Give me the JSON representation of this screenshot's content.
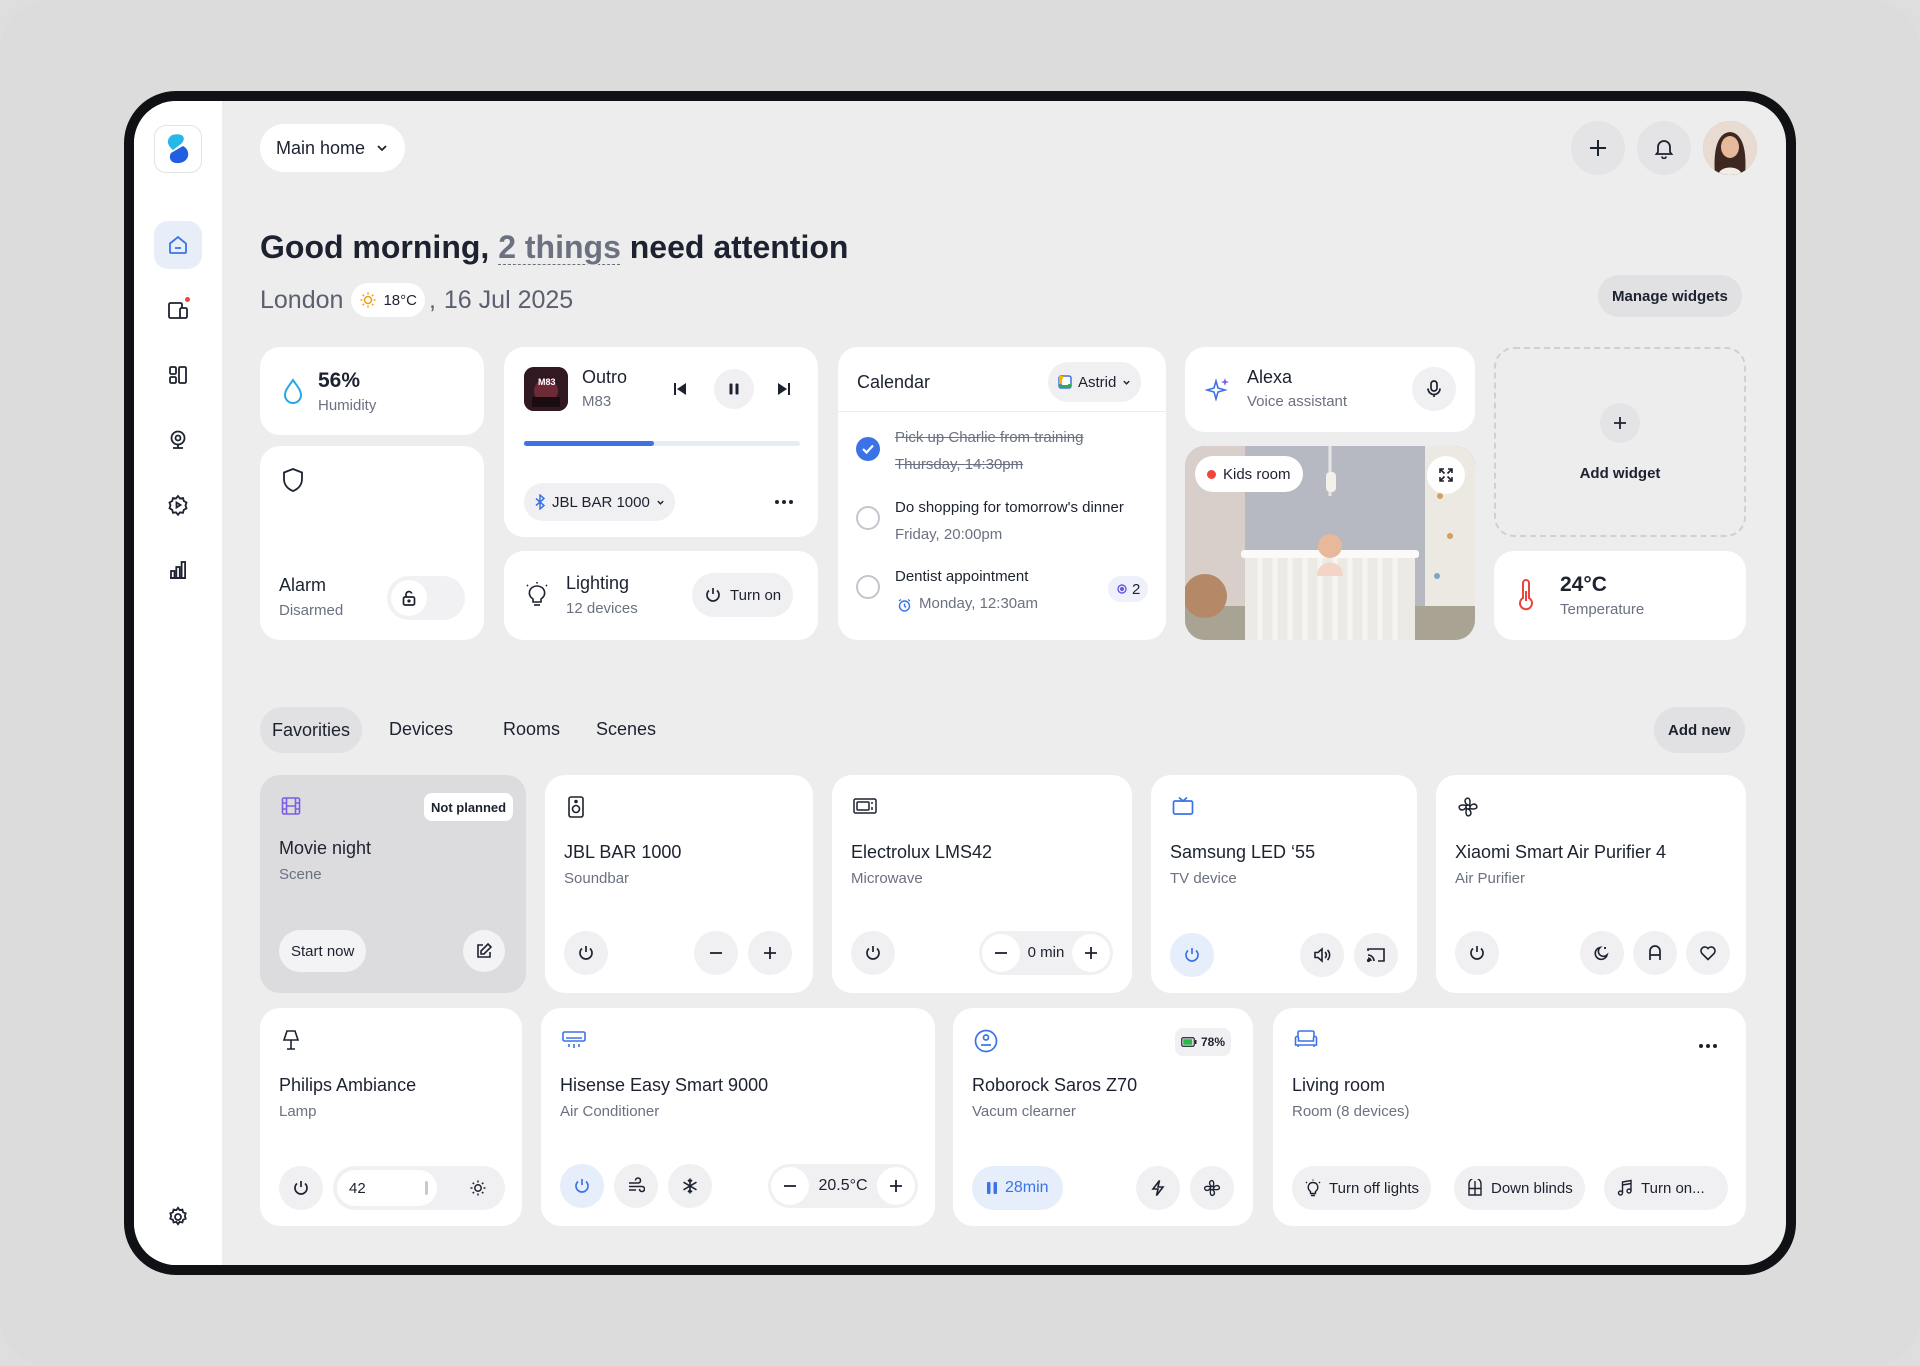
{
  "header": {
    "home_selector": "Main home",
    "greeting_prefix": "Good morning, ",
    "greeting_link": "2 things",
    "greeting_suffix": " need attention",
    "city": "London",
    "weather_temp": "18°C",
    "date_sep": ",",
    "date": "16 Jul 2025",
    "manage_widgets": "Manage widgets"
  },
  "widgets": {
    "humidity": {
      "value": "56%",
      "label": "Humidity"
    },
    "alarm": {
      "title": "Alarm",
      "status": "Disarmed"
    },
    "music": {
      "track": "Outro",
      "artist": "M83",
      "album_art_text": "M83",
      "progress": 0.47,
      "device": "JBL BAR 1000"
    },
    "lighting": {
      "title": "Lighting",
      "subtitle": "12 devices",
      "action": "Turn on"
    },
    "calendar": {
      "title": "Calendar",
      "account": "Astrid",
      "items": [
        {
          "title": "Pick up Charlie from training",
          "time": "Thursday, 14:30pm",
          "done": true
        },
        {
          "title": "Do shopping for tomorrow's dinner",
          "time": "Friday, 20:00pm",
          "done": false
        },
        {
          "title": "Dentist appointment",
          "time": "Monday, 12:30am",
          "done": false,
          "badge": "2"
        }
      ]
    },
    "alexa": {
      "title": "Alexa",
      "subtitle": "Voice assistant"
    },
    "camera": {
      "label": "Kids room"
    },
    "add_widget": {
      "label": "Add widget"
    },
    "temperature": {
      "value": "24°C",
      "label": "Temperature"
    }
  },
  "tabs": {
    "items": [
      "Favorities",
      "Devices",
      "Rooms",
      "Scenes"
    ],
    "active": "Favorities",
    "add_new": "Add new"
  },
  "devices": {
    "movie": {
      "badge": "Not planned",
      "title": "Movie night",
      "type": "Scene",
      "action": "Start now"
    },
    "jbl": {
      "title": "JBL BAR 1000",
      "type": "Soundbar"
    },
    "electrolux": {
      "title": "Electrolux LMS42",
      "type": "Microwave",
      "timer": "0 min"
    },
    "samsung": {
      "title": "Samsung LED ‘55",
      "type": "TV device"
    },
    "xiaomi": {
      "title": "Xiaomi Smart Air Purifier 4",
      "type": "Air Purifier"
    },
    "philips": {
      "title": "Philips Ambiance",
      "type": "Lamp",
      "brightness": "42"
    },
    "hisense": {
      "title": "Hisense Easy Smart 9000",
      "type": "Air Conditioner",
      "temperature": "20.5°C"
    },
    "roborock": {
      "battery": "78%",
      "title": "Roborock Saros Z70",
      "type": "Vacum clearner",
      "timer": "28min"
    },
    "living": {
      "title": "Living room",
      "type": "Room (8 devices)",
      "actions": [
        "Turn off lights",
        "Down blinds",
        "Turn on..."
      ]
    }
  },
  "colors": {
    "accent": "#3b73e6",
    "background": "#ededed",
    "card": "#ffffff",
    "alert": "#f0453a"
  }
}
